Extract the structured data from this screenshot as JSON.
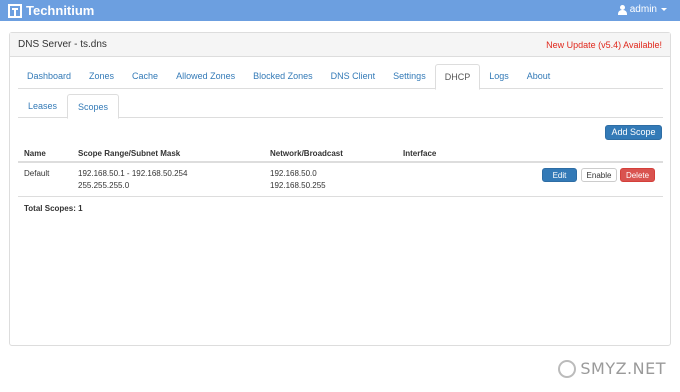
{
  "app": {
    "name": "Technitium",
    "user": "admin"
  },
  "panel": {
    "title": "DNS Server - ts.dns",
    "update_notice": "New Update (v5.4) Available!"
  },
  "tabs": [
    {
      "label": "Dashboard"
    },
    {
      "label": "Zones"
    },
    {
      "label": "Cache"
    },
    {
      "label": "Allowed Zones"
    },
    {
      "label": "Blocked Zones"
    },
    {
      "label": "DNS Client"
    },
    {
      "label": "Settings"
    },
    {
      "label": "DHCP"
    },
    {
      "label": "Logs"
    },
    {
      "label": "About"
    }
  ],
  "subtabs": [
    {
      "label": "Leases"
    },
    {
      "label": "Scopes"
    }
  ],
  "add_scope_label": "Add Scope",
  "table": {
    "headers": [
      "Name",
      "Scope Range/Subnet Mask",
      "Network/Broadcast",
      "Interface"
    ],
    "rows": [
      {
        "name": "Default",
        "range": "192.168.50.1 - 192.168.50.254",
        "mask": "255.255.255.0",
        "network": "192.168.50.0",
        "broadcast": "192.168.50.255",
        "interface": "",
        "actions": {
          "edit": "Edit",
          "enable": "Enable",
          "delete": "Delete"
        }
      }
    ]
  },
  "total": "Total Scopes: 1",
  "watermark": "SMYZ.NET"
}
